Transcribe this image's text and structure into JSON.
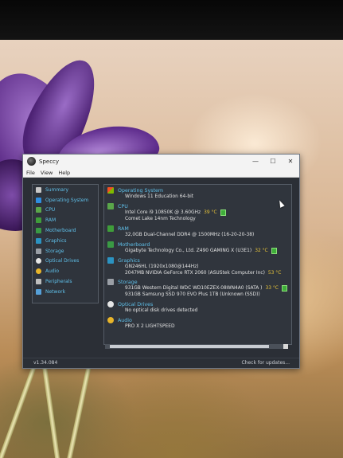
{
  "window": {
    "title": "Speccy",
    "controls": {
      "minimize": "—",
      "maximize": "☐",
      "close": "✕"
    }
  },
  "menu": [
    "File",
    "View",
    "Help"
  ],
  "sidebar": {
    "items": [
      {
        "label": "Summary",
        "icon": "summary-icon",
        "color": "#c9c9c9"
      },
      {
        "label": "Operating System",
        "icon": "windows-icon",
        "color": "#2f8ee0"
      },
      {
        "label": "CPU",
        "icon": "cpu-icon",
        "color": "#5aa64a"
      },
      {
        "label": "RAM",
        "icon": "ram-icon",
        "color": "#3f9d3a"
      },
      {
        "label": "Motherboard",
        "icon": "motherboard-icon",
        "color": "#3a9a44"
      },
      {
        "label": "Graphics",
        "icon": "graphics-icon",
        "color": "#2b93c2"
      },
      {
        "label": "Storage",
        "icon": "storage-icon",
        "color": "#9a9fa6"
      },
      {
        "label": "Optical Drives",
        "icon": "optical-drive-icon",
        "color": "#e6e6e6"
      },
      {
        "label": "Audio",
        "icon": "audio-icon",
        "color": "#e8b52a"
      },
      {
        "label": "Peripherals",
        "icon": "peripherals-icon",
        "color": "#bfbfbf"
      },
      {
        "label": "Network",
        "icon": "network-icon",
        "color": "#56a0d8"
      }
    ]
  },
  "summary": {
    "os": {
      "title": "Operating System",
      "lines": [
        "Windows 11 Education 64-bit"
      ]
    },
    "cpu": {
      "title": "CPU",
      "line1": "Intel Core i9 10850K @ 3.60GHz",
      "temp": "39 °C",
      "line2": "Comet Lake 14nm Technology"
    },
    "ram": {
      "title": "RAM",
      "line1": "32,0GB Dual-Channel DDR4 @ 1500MHz (16-20-20-38)"
    },
    "motherboard": {
      "title": "Motherboard",
      "line1": "Gigabyte Technology Co., Ltd. Z490 GAMING X (U3E1)",
      "temp": "32 °C"
    },
    "graphics": {
      "title": "Graphics",
      "line1": "GN246HL (1920x1080@144Hz)",
      "line2": "2047MB NVIDIA GeForce RTX 2060 (ASUStek Computer Inc)",
      "temp": "53 °C"
    },
    "storage": {
      "title": "Storage",
      "line1": "931GB Western Digital WDC WD10EZEX-08WN4A0 (SATA )",
      "temp": "33 °C",
      "line2": "931GB Samsung SSD 970 EVO Plus 1TB (Unknown (SSD))"
    },
    "optical": {
      "title": "Optical Drives",
      "line1": "No optical disk drives detected"
    },
    "audio": {
      "title": "Audio",
      "line1": "PRO X 2 LIGHTSPEED"
    }
  },
  "status": {
    "version": "v1.34.084",
    "update": "Check for updates..."
  }
}
